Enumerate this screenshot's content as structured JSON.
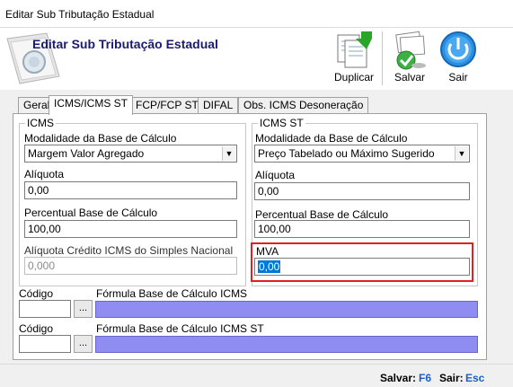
{
  "window": {
    "title": "Editar Sub Tributação Estadual"
  },
  "header": {
    "title": "Editar Sub Tributação Estadual"
  },
  "toolbar": {
    "duplicate_label": "Duplicar",
    "save_label": "Salvar",
    "exit_label": "Sair"
  },
  "tabs": [
    {
      "label": "Geral"
    },
    {
      "label": "ICMS/ICMS ST",
      "active": true
    },
    {
      "label": "FCP/FCP ST"
    },
    {
      "label": "DIFAL"
    },
    {
      "label": "Obs. ICMS Desoneração"
    }
  ],
  "icms": {
    "legend": "ICMS",
    "modalidade_label": "Modalidade da Base de Cálculo",
    "modalidade_value": "Margem Valor Agregado",
    "aliquota_label": "Alíquota",
    "aliquota_value": "0,00",
    "percentual_label": "Percentual Base de Cálculo",
    "percentual_value": "100,00",
    "credito_label": "Alíquota Crédito ICMS do Simples Nacional",
    "credito_value": "0,000"
  },
  "icms_st": {
    "legend": "ICMS ST",
    "modalidade_label": "Modalidade da Base de Cálculo",
    "modalidade_value": "Preço Tabelado ou Máximo Sugerido",
    "aliquota_label": "Alíquota",
    "aliquota_value": "0,00",
    "percentual_label": "Percentual Base de Cálculo",
    "percentual_value": "100,00",
    "mva_label": "MVA",
    "mva_value": "0,00"
  },
  "formulas": [
    {
      "code_label": "Código",
      "formula_label": "Fórmula Base de Cálculo ICMS",
      "dots": "..."
    },
    {
      "code_label": "Código",
      "formula_label": "Fórmula Base de Cálculo ICMS ST",
      "dots": "..."
    }
  ],
  "status": {
    "save_text": "Salvar:",
    "save_key": "F6",
    "exit_text": "Sair:",
    "exit_key": "Esc"
  },
  "colors": {
    "formula_fill": "#8f8cf2",
    "highlight": "#e12121",
    "selection": "#0078d7",
    "header_title": "#1a1a6e"
  }
}
